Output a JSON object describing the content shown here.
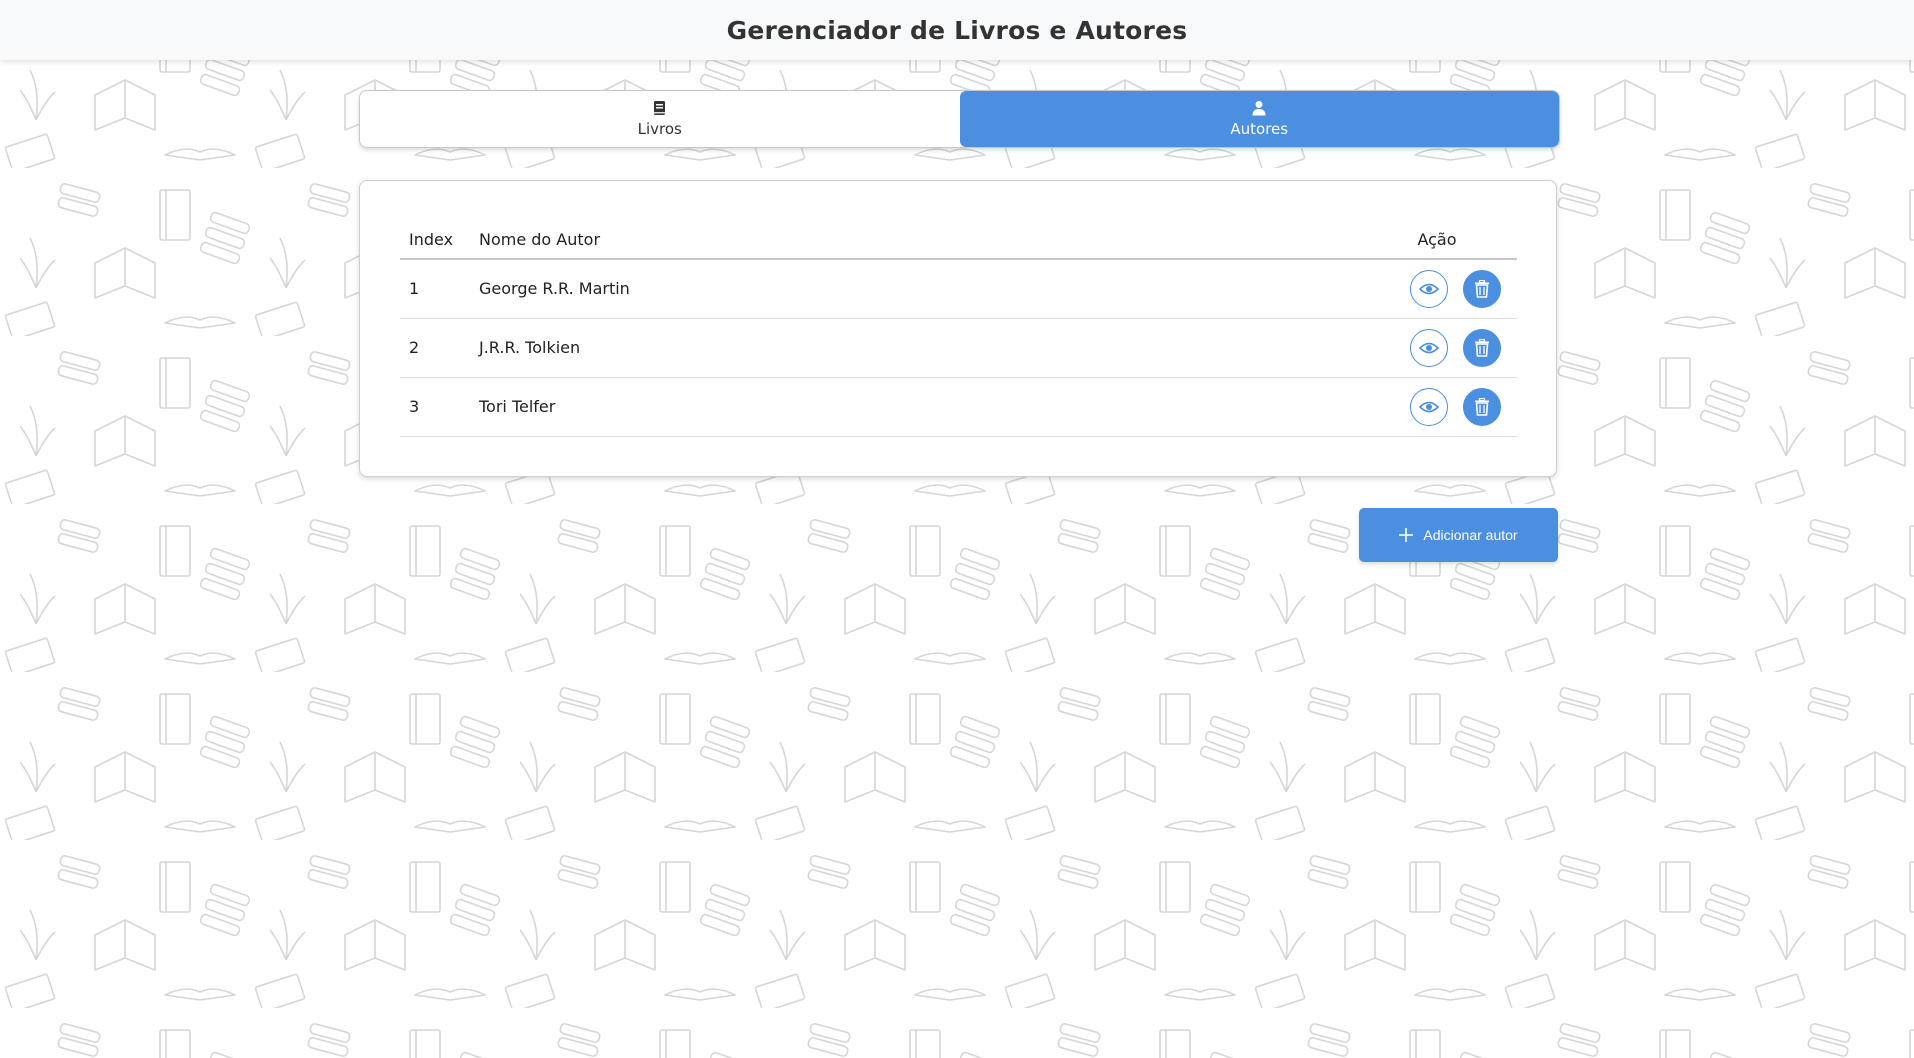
{
  "header": {
    "title": "Gerenciador de Livros e Autores"
  },
  "tabs": [
    {
      "label": "Livros",
      "icon": "book-icon",
      "active": false
    },
    {
      "label": "Autores",
      "icon": "user-icon",
      "active": true
    }
  ],
  "table": {
    "headers": {
      "index": "Index",
      "name": "Nome do Autor",
      "action": "Ação"
    },
    "rows": [
      {
        "index": "1",
        "name": "George R.R. Martin"
      },
      {
        "index": "2",
        "name": "J.R.R. Tolkien"
      },
      {
        "index": "3",
        "name": "Tori Telfer"
      }
    ]
  },
  "add_button": {
    "label": "Adicionar autor",
    "icon": "plus-icon"
  },
  "colors": {
    "accent": "#4a8fe0",
    "header_bg": "#f8f9fa",
    "pattern": "#d6d6d6"
  }
}
